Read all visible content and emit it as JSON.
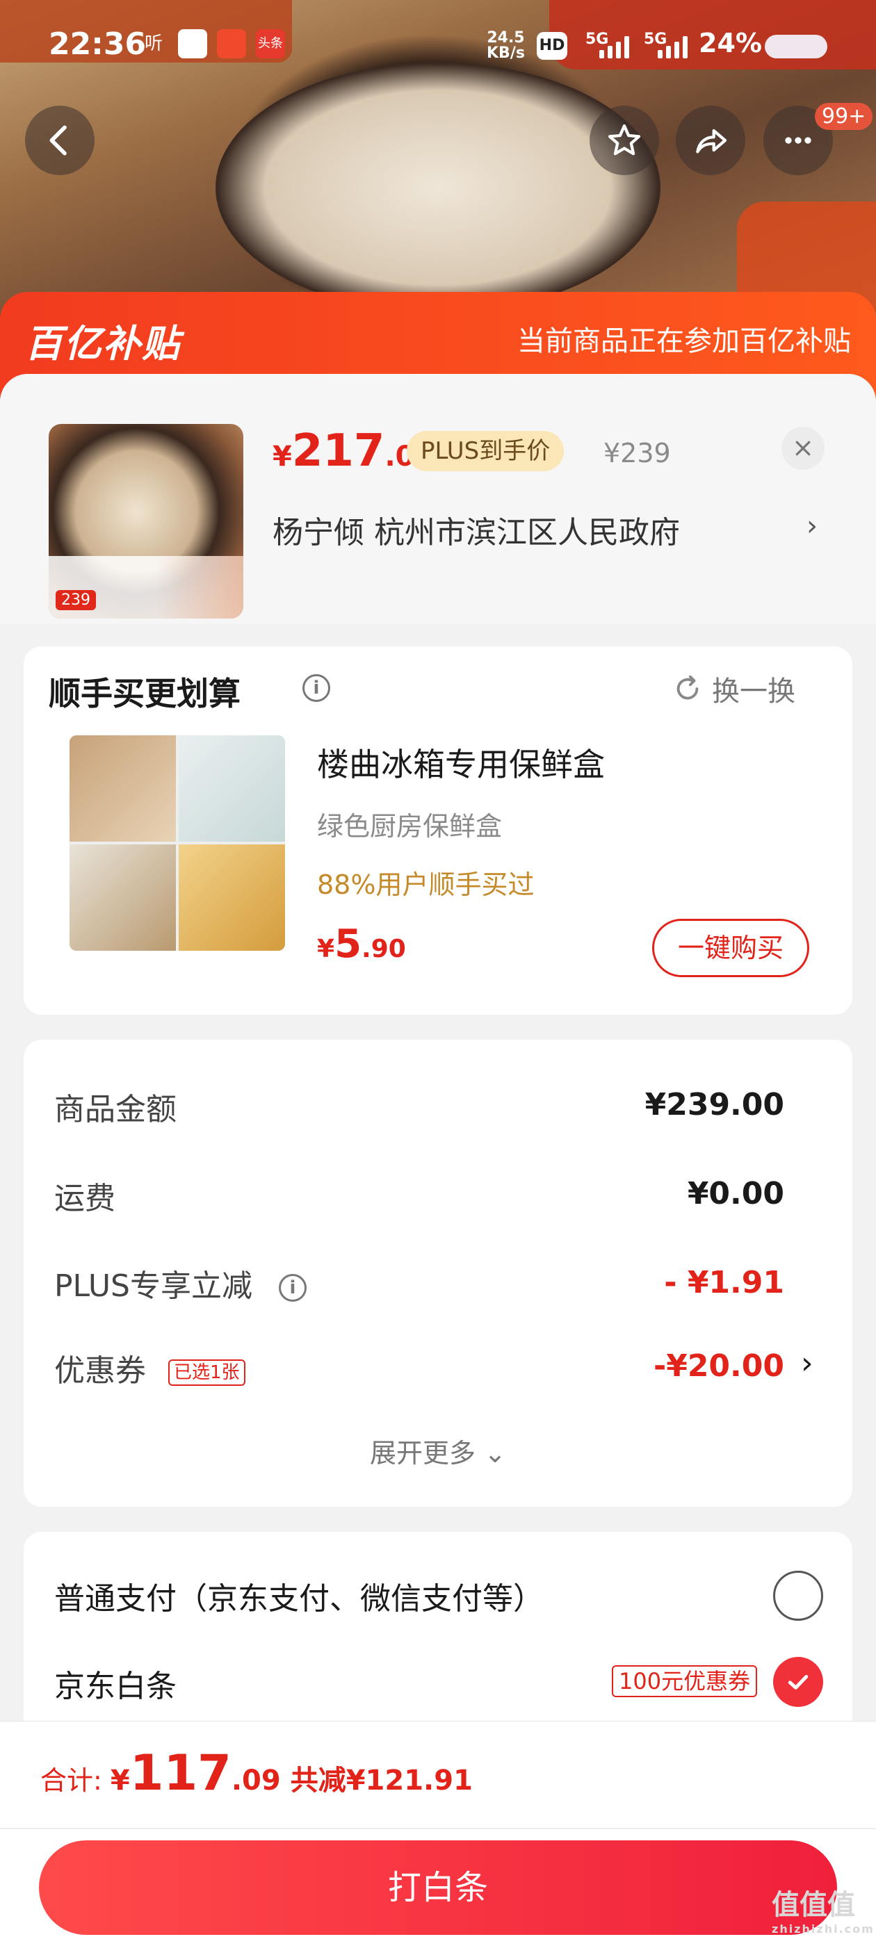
{
  "status_bar": {
    "time": "22:36",
    "app_icons": [
      "听",
      "",
      "",
      "头条"
    ],
    "network_speed": "24.5",
    "network_unit": "KB/s",
    "hd": "HD",
    "sig1": "5G",
    "sig2": "5G",
    "battery": "24%"
  },
  "nav": {
    "badge": "99+",
    "icons": [
      "back-icon",
      "star-icon",
      "share-icon",
      "more-icon"
    ]
  },
  "banner": {
    "logo": "百亿补贴",
    "text": "当前商品正在参加百亿补贴"
  },
  "product": {
    "price_symbol": "¥",
    "price_int": "217",
    "price_dec": ".09",
    "plus_label": "PLUS到手价",
    "original_price": "¥239",
    "address": "杨宁倾  杭州市滨江区人民政府",
    "address_arrow": "›",
    "thumb_price": "239"
  },
  "recommend": {
    "title": "顺手买更划算",
    "info": "i",
    "swap": "换一换",
    "name": "楼曲冰箱专用保鲜盒",
    "subtitle": "绿色厨房保鲜盒",
    "rate": "88%用户顺手买过",
    "price_symbol": "¥",
    "price_int": "5",
    "price_dec": ".90",
    "buy_label": "一键购买"
  },
  "summary": {
    "rows": [
      {
        "label": "商品金额",
        "value": "¥239.00"
      },
      {
        "label": "运费",
        "value": "¥0.00"
      },
      {
        "label": "PLUS专享立减",
        "value": "- ¥1.91"
      },
      {
        "label": "优惠券",
        "value": "-¥20.00"
      }
    ],
    "coupon_tag": "已选1张",
    "coupon_arrow": "›",
    "expand": "展开更多 ⌄"
  },
  "payment": {
    "options": [
      {
        "label": "普通支付（京东支付、微信支付等）",
        "selected": false
      },
      {
        "label": "京东白条",
        "selected": true
      }
    ],
    "baitiao_tag": "100元优惠券"
  },
  "footer": {
    "total_label": "合计: ",
    "total_symbol": "¥",
    "total_int": "117",
    "total_dec": ".09",
    "saved": "共减¥121.91",
    "pay_button": "打白条",
    "watermark": "值值值",
    "watermark_url": "zhizhizhi.com"
  },
  "colors": {
    "accent_red": "#e2231a",
    "banner_orange": "#ff5a1d",
    "plus_gold": "#fbe6b8"
  }
}
